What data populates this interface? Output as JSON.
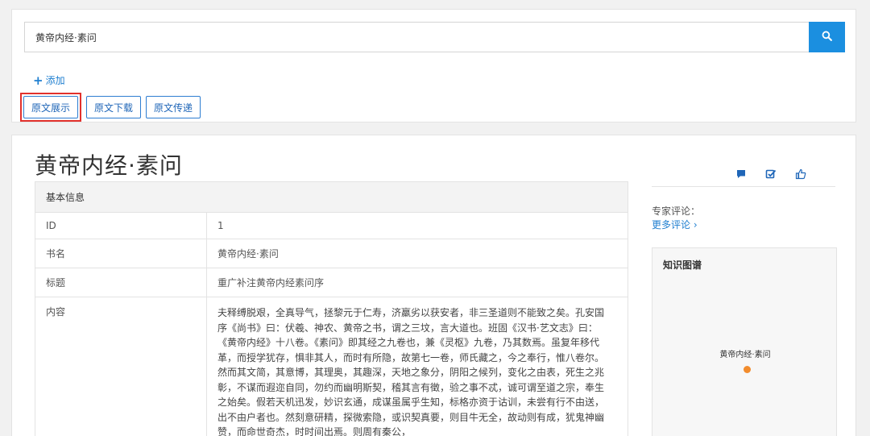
{
  "search": {
    "value": "黄帝内经·素问"
  },
  "add": {
    "label": "添加"
  },
  "buttons": {
    "show_original": "原文展示",
    "download_original": "原文下载",
    "deliver_original": "原文传递"
  },
  "record": {
    "title": "黄帝内经·素问",
    "section_header": "基本信息",
    "rows": [
      {
        "key": "ID",
        "value": "1"
      },
      {
        "key": "书名",
        "value": "黄帝内经·素问"
      },
      {
        "key": "标题",
        "value": "重广补注黄帝内经素问序"
      },
      {
        "key": "内容",
        "value": "夫释缚脱艰，全真导气，拯黎元于仁寿，济羸劣以获安者，非三圣道则不能致之矣。孔安国序《尚书》曰：伏羲、神农、黄帝之书，谓之三坟，言大道也。班固《汉书·艺文志》曰：《黄帝内经》十八卷。《素问》即其经之九卷也，兼《灵枢》九卷，乃其数焉。虽复年移代革，而授学犹存，惧非其人，而时有所隐，故第七一卷，师氏藏之，今之奉行，惟八卷尔。然而其文简，其意博，其理奥，其趣深，天地之象分，阴阳之候列，变化之由表，死生之兆彰，不谋而遐迩自同，勿约而幽明斯契，稽其言有徵，验之事不忒，诚可谓至道之宗，奉生之始矣。假若天机迅发，妙识玄通，成谋虽属乎生知，标格亦资于诂训，未尝有行不由送，出不由户者也。然刻意研精，探微索隐，或识契真要，则目牛无全，故动则有成，犹鬼神幽赞，而命世奇杰，时时间出焉。则周有秦公，"
      }
    ]
  },
  "sidebar": {
    "expert_label": "专家评论：",
    "more_comments": "更多评论 ›"
  },
  "knowledge_graph": {
    "title": "知识图谱",
    "node_label": "黄帝内经·素问"
  },
  "colors": {
    "primary": "#1b8fe0",
    "highlight": "#e2312c",
    "node": "#f28c2d"
  }
}
